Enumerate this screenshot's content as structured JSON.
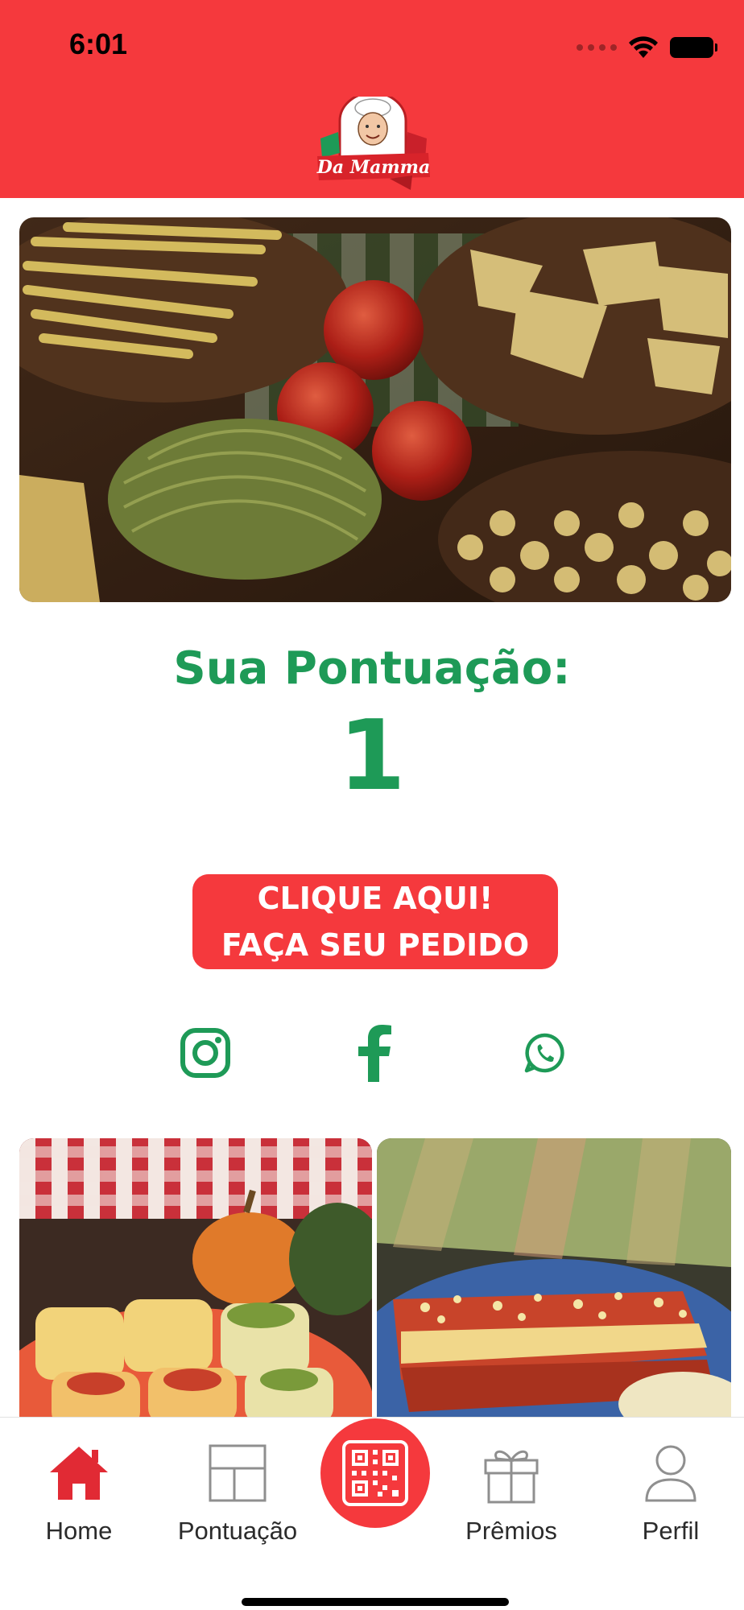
{
  "colors": {
    "brand_red": "#f5393d",
    "brand_green": "#1e9a57",
    "tab_active": "#e12a34",
    "tab_inactive": "#8f8f8f"
  },
  "status_bar": {
    "time": "6:01"
  },
  "header": {
    "logo_text": "Da Mamma"
  },
  "score": {
    "title": "Sua Pontuação:",
    "value": "1"
  },
  "order_button": {
    "line1": "CLIQUE AQUI!",
    "line2": "FAÇA SEU PEDIDO"
  },
  "social": {
    "instagram_icon": "instagram-icon",
    "facebook_icon": "facebook-icon",
    "whatsapp_icon": "whatsapp-icon"
  },
  "tabs": [
    {
      "label": "Home",
      "icon": "home-icon",
      "active": true
    },
    {
      "label": "Pontuação",
      "icon": "layout-icon",
      "active": false
    },
    {
      "label": "Prêmios",
      "icon": "gift-icon",
      "active": false
    },
    {
      "label": "Perfil",
      "icon": "user-icon",
      "active": false
    }
  ],
  "center_tab": {
    "icon": "qr-code-icon"
  }
}
